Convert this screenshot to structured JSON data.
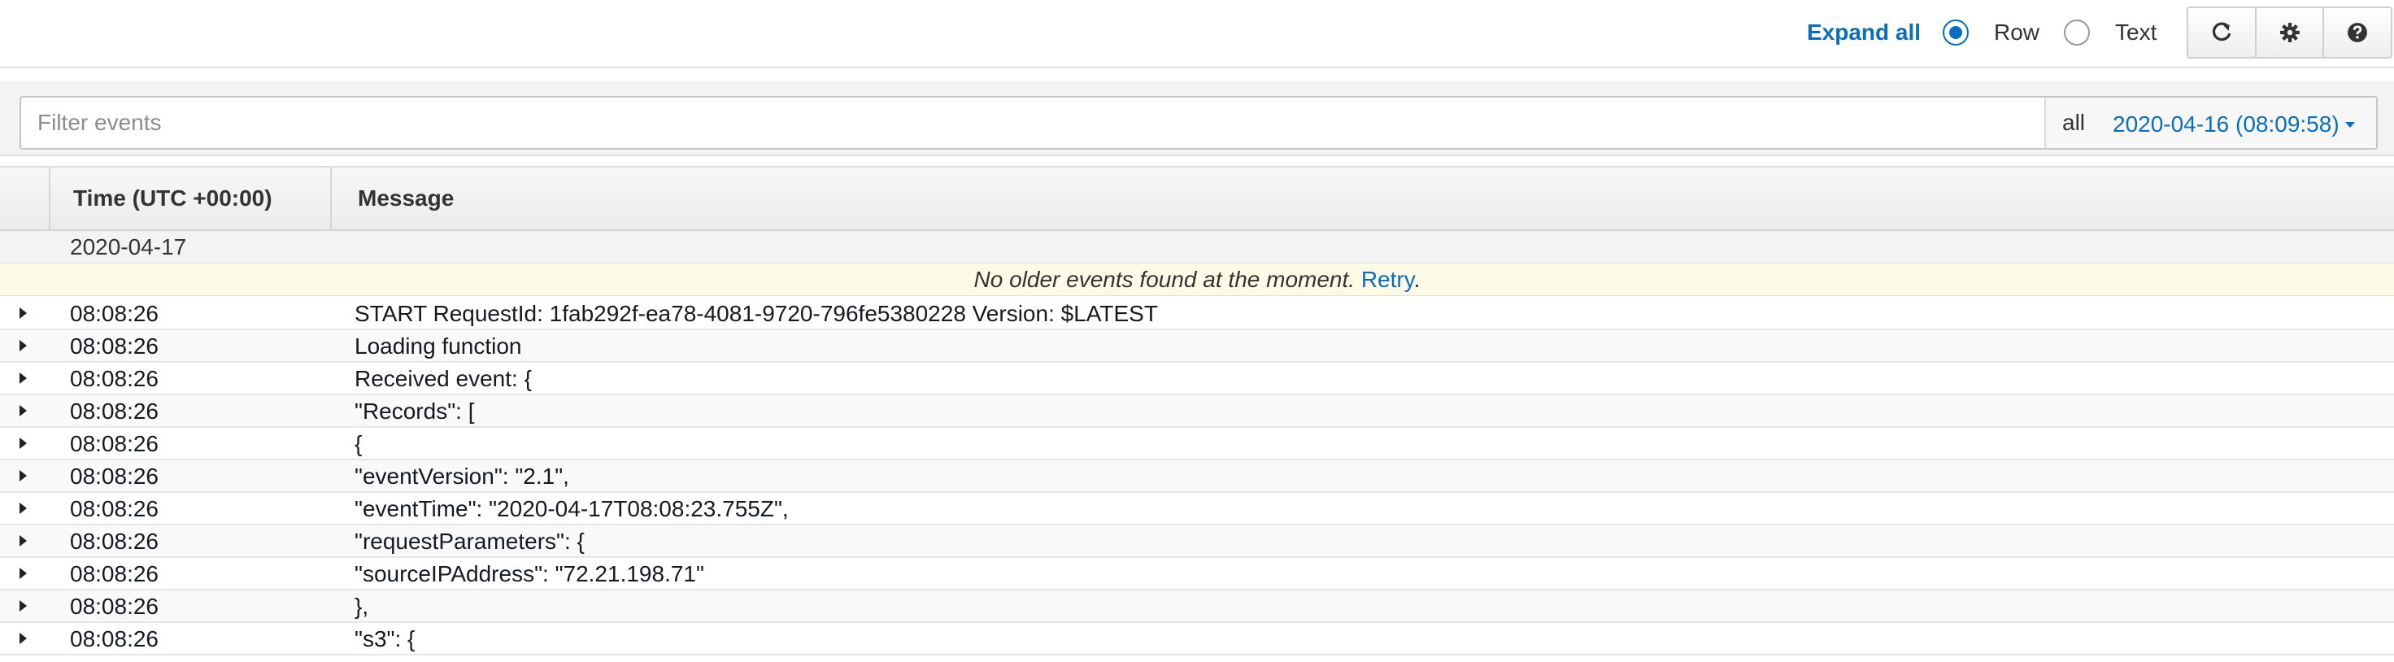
{
  "toolbar": {
    "expand_all": "Expand all",
    "view_options": [
      {
        "label": "Row",
        "selected": true
      },
      {
        "label": "Text",
        "selected": false
      }
    ],
    "buttons": [
      {
        "icon": "refresh-icon"
      },
      {
        "icon": "gear-icon"
      },
      {
        "icon": "help-icon"
      }
    ]
  },
  "filter": {
    "placeholder": "Filter events",
    "value": "",
    "range_label": "all",
    "date_selection": "2020-04-16 (08:09:58)"
  },
  "table": {
    "columns": [
      "Time (UTC +00:00)",
      "Message"
    ],
    "date_group": "2020-04-17",
    "notice": {
      "text": "No older events found at the moment.",
      "link": "Retry",
      "suffix": "."
    },
    "rows": [
      {
        "time": "08:08:26",
        "message": "START RequestId: 1fab292f-ea78-4081-9720-796fe5380228 Version: $LATEST"
      },
      {
        "time": "08:08:26",
        "message": "Loading function"
      },
      {
        "time": "08:08:26",
        "message": "Received event: {"
      },
      {
        "time": "08:08:26",
        "message": "\"Records\": ["
      },
      {
        "time": "08:08:26",
        "message": "{"
      },
      {
        "time": "08:08:26",
        "message": "\"eventVersion\": \"2.1\","
      },
      {
        "time": "08:08:26",
        "message": "\"eventTime\": \"2020-04-17T08:08:23.755Z\","
      },
      {
        "time": "08:08:26",
        "message": "\"requestParameters\": {"
      },
      {
        "time": "08:08:26",
        "message": "\"sourceIPAddress\": \"72.21.198.71\""
      },
      {
        "time": "08:08:26",
        "message": "},"
      },
      {
        "time": "08:08:26",
        "message": "\"s3\": {"
      }
    ]
  },
  "colors": {
    "accent": "#0a6ebd",
    "notice_bg": "#fdfbe6",
    "header_bg": "#ececec"
  }
}
